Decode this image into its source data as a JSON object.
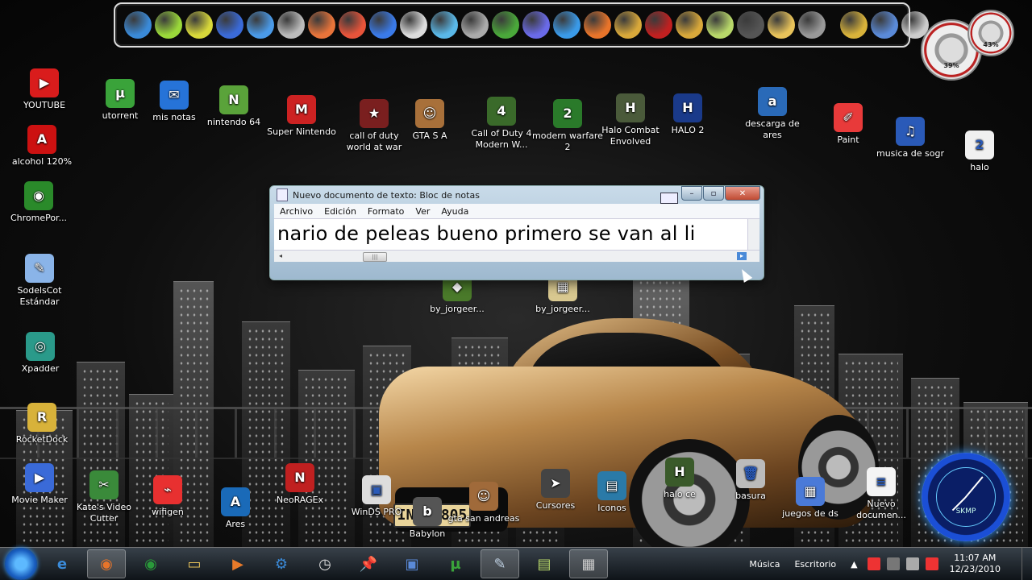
{
  "dock": {
    "icons": [
      "rocketdock-icon",
      "nvidia-icon",
      "xpadder-icon",
      "safari-icon",
      "cursor-icon",
      "camera-icon",
      "hand-icon",
      "firefox-red-icon",
      "bolt-icon",
      "usb-icon",
      "itunes-icon",
      "tools-icon",
      "chrome-green-icon",
      "gamepad-icon",
      "ie-icon",
      "firefox-icon",
      "chrome-icon",
      "download-icon",
      "guitar-icon",
      "note-icon",
      "film-icon",
      "folder-icon",
      "eraser-icon"
    ],
    "right_icons": [
      "hammer-icon",
      "folder-blue-icon",
      "recycle-icon"
    ]
  },
  "gauges": {
    "cpu": "39%",
    "ram": "43%"
  },
  "desktop_icons": [
    {
      "id": "youtube",
      "label": "YOUTUBE",
      "color": "#d91c1c",
      "glyph": "▶"
    },
    {
      "id": "alcohol",
      "label": "alcohol 120%",
      "color": "#c11",
      "glyph": "A"
    },
    {
      "id": "chromeportable",
      "label": "ChromePor...",
      "color": "#2a8a2a",
      "glyph": "◉"
    },
    {
      "id": "sodelscot",
      "label": "SodelsCot Estándar",
      "color": "#8ab4e8",
      "glyph": "✎"
    },
    {
      "id": "xpadder",
      "label": "Xpadder",
      "color": "#2a9a8a",
      "glyph": "◎"
    },
    {
      "id": "rocketdock",
      "label": "RocketDock",
      "color": "#d8b23a",
      "glyph": "R"
    },
    {
      "id": "utorrent",
      "label": "utorrent",
      "color": "#3aa33a",
      "glyph": "µ"
    },
    {
      "id": "misnotas",
      "label": "mis notas",
      "color": "#2673d8",
      "glyph": "✉"
    },
    {
      "id": "nintendo64",
      "label": "nintendo 64",
      "color": "#5aa33a",
      "glyph": "N"
    },
    {
      "id": "supernintendo",
      "label": "Super Nintendo",
      "color": "#c22",
      "glyph": "M"
    },
    {
      "id": "callofdutyworldatwar",
      "label": "call of duty world at war",
      "color": "#7a1f1f",
      "glyph": "★"
    },
    {
      "id": "gtasa",
      "label": "GTA S A",
      "color": "#a8703a",
      "glyph": "☺"
    },
    {
      "id": "cod4",
      "label": "Call of Duty 4 Modern W...",
      "color": "#3a6a2a",
      "glyph": "4"
    },
    {
      "id": "mw2",
      "label": "modern warfare 2",
      "color": "#2a7a2a",
      "glyph": "2"
    },
    {
      "id": "halocombat",
      "label": "Halo Combat Envolved",
      "color": "#4a5a3a",
      "glyph": "H"
    },
    {
      "id": "halo2",
      "label": "HALO 2",
      "color": "#1a3a8a",
      "glyph": "H"
    },
    {
      "id": "ares",
      "label": "descarga de ares",
      "color": "#2a6ab8",
      "glyph": "a"
    },
    {
      "id": "paint",
      "label": "Paint",
      "color": "#e83a3a",
      "glyph": "✐"
    },
    {
      "id": "musicadesogr",
      "label": "musica de sogr",
      "color": "#2a5ab8",
      "glyph": "♫"
    },
    {
      "id": "halo",
      "label": "halo",
      "color": "#f0f0f0",
      "glyph": "2"
    },
    {
      "id": "byjorge1",
      "label": "by_jorgeer...",
      "color": "#4a7a2a",
      "glyph": "◆"
    },
    {
      "id": "byjorge2",
      "label": "by_jorgeer...",
      "color": "#d8c890",
      "glyph": "▦"
    },
    {
      "id": "moviemaker",
      "label": "Movie Maker",
      "color": "#3a6ad8",
      "glyph": "▶"
    },
    {
      "id": "katesvideo",
      "label": "Kate's Video Cutter",
      "color": "#3a8a3a",
      "glyph": "✂"
    },
    {
      "id": "wifigen",
      "label": "wifigen",
      "color": "#e83030",
      "glyph": "⌁"
    },
    {
      "id": "aresdesk",
      "label": "Ares",
      "color": "#1a6ab8",
      "glyph": "A"
    },
    {
      "id": "neorageex",
      "label": "NeoRAGEx",
      "color": "#c02020",
      "glyph": "N"
    },
    {
      "id": "windspro",
      "label": "WinDS PRO",
      "color": "#ddd",
      "glyph": "▣"
    },
    {
      "id": "babylon",
      "label": "Babylon",
      "color": "#555",
      "glyph": "b"
    },
    {
      "id": "gtasanandreas",
      "label": "gta san andreas",
      "color": "#a06a3a",
      "glyph": "☺"
    },
    {
      "id": "cursores",
      "label": "Cursores",
      "color": "#444",
      "glyph": "➤"
    },
    {
      "id": "iconos",
      "label": "Iconos",
      "color": "#2a7aa8",
      "glyph": "▤"
    },
    {
      "id": "haloce",
      "label": "halo ce",
      "color": "#3a5a2a",
      "glyph": "H"
    },
    {
      "id": "basura",
      "label": "basura",
      "color": "#bbb",
      "glyph": "🗑"
    },
    {
      "id": "juegosdeds",
      "label": "juegos de ds",
      "color": "#4a7ad8",
      "glyph": "▦"
    },
    {
      "id": "nuevodocumento",
      "label": "Nuevo documen...",
      "color": "#f4f4f4",
      "glyph": "≡"
    }
  ],
  "notepad": {
    "title": "Nuevo documento de texto: Bloc de notas",
    "menu": [
      "Archivo",
      "Edición",
      "Formato",
      "Ver",
      "Ayuda"
    ],
    "content": "nario de peleas bueno primero se van al li",
    "minimize": "–",
    "maximize": "▫",
    "close": "✕",
    "scroll_thumb": "|||",
    "scroll_left": "◂",
    "scroll_right": "▸"
  },
  "clock": {
    "brand": "SKMP"
  },
  "plate": "IN R 805",
  "taskbar": {
    "buttons": [
      {
        "id": "ie",
        "color": "#3a8ad8",
        "glyph": "e"
      },
      {
        "id": "firefox",
        "color": "#e8742a",
        "glyph": "◉",
        "active": true
      },
      {
        "id": "chrome",
        "color": "#2a9a3a",
        "glyph": "◉"
      },
      {
        "id": "explorer",
        "color": "#e8c35a",
        "glyph": "▭"
      },
      {
        "id": "mediaplayer",
        "color": "#e87a2a",
        "glyph": "▶"
      },
      {
        "id": "settings",
        "color": "#3a8ad8",
        "glyph": "⚙"
      },
      {
        "id": "clockapp",
        "color": "#ddd",
        "glyph": "◷"
      },
      {
        "id": "pin",
        "color": "#e83a3a",
        "glyph": "📌"
      },
      {
        "id": "monitor",
        "color": "#5a8ad8",
        "glyph": "▣"
      },
      {
        "id": "utorrent",
        "color": "#3aa33a",
        "glyph": "µ"
      },
      {
        "id": "notepad",
        "color": "#bcd",
        "glyph": "✎",
        "active": true
      },
      {
        "id": "notes",
        "color": "#b8d86a",
        "glyph": "▤"
      },
      {
        "id": "camera",
        "color": "#ccc",
        "glyph": "▦",
        "active": true
      }
    ],
    "toolbar_musica": "Música",
    "toolbar_escritorio": "Escritorio",
    "time": "11:07 AM",
    "date": "12/23/2010"
  }
}
